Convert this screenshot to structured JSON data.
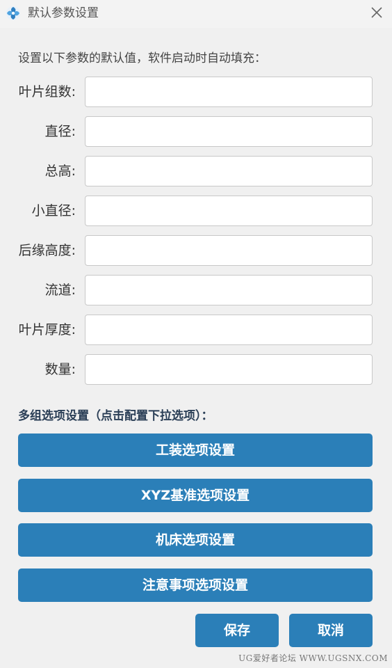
{
  "window": {
    "title": "默认参数设置",
    "icon": "app-logo-icon",
    "close_icon": "close-icon"
  },
  "intro_text": "设置以下参数的默认值，软件启动时自动填充：",
  "fields": [
    {
      "label": "叶片组数:",
      "value": "",
      "placeholder": ""
    },
    {
      "label": "直径:",
      "value": "",
      "placeholder": ""
    },
    {
      "label": "总高:",
      "value": "",
      "placeholder": ""
    },
    {
      "label": "小直径:",
      "value": "",
      "placeholder": ""
    },
    {
      "label": "后缘高度:",
      "value": "",
      "placeholder": ""
    },
    {
      "label": "流道:",
      "value": "",
      "placeholder": ""
    },
    {
      "label": "叶片厚度:",
      "value": "",
      "placeholder": ""
    },
    {
      "label": "数量:",
      "value": "",
      "placeholder": ""
    }
  ],
  "options_section": {
    "title": "多组选项设置（点击配置下拉选项）：",
    "buttons": [
      {
        "label": "工装选项设置"
      },
      {
        "label": "XYZ基准选项设置"
      },
      {
        "label": "机床选项设置"
      },
      {
        "label": "注意事项选项设置"
      }
    ]
  },
  "actions": {
    "save_label": "保存",
    "cancel_label": "取消"
  },
  "watermark": "UG爱好者论坛 WWW.UGSNX.COM",
  "colors": {
    "accent": "#2b7fb8",
    "background": "#f0f0f0",
    "section_title": "#2a3e56"
  }
}
